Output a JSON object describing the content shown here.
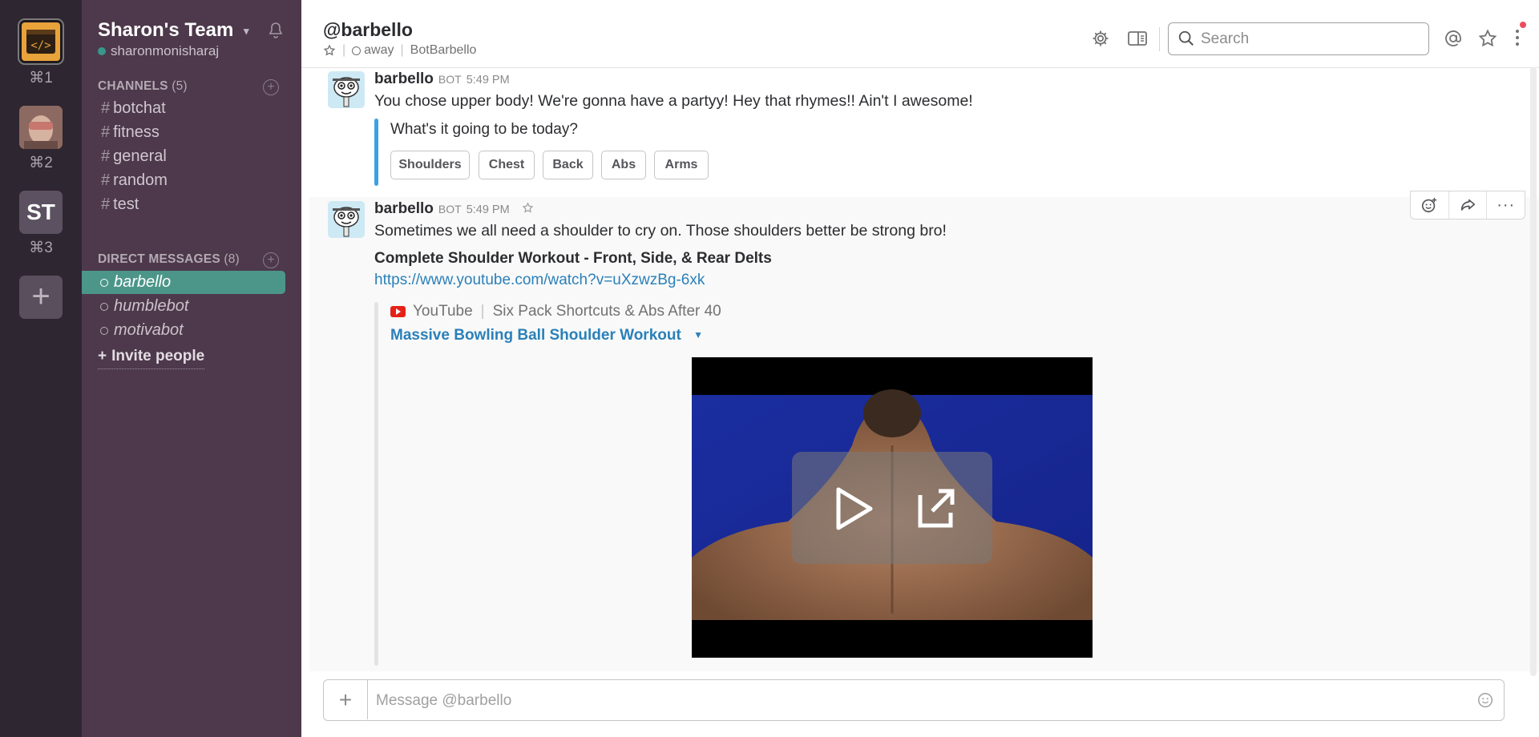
{
  "teams_rail": {
    "shortcuts": [
      "⌘1",
      "⌘2",
      "⌘3"
    ],
    "team3_initials": "ST"
  },
  "sidebar": {
    "team_name": "Sharon's Team",
    "username": "sharonmonisharaj",
    "channels_label": "CHANNELS",
    "channels_count": "(5)",
    "channels": [
      "botchat",
      "fitness",
      "general",
      "random",
      "test"
    ],
    "dms_label": "DIRECT MESSAGES",
    "dms_count": "(8)",
    "dms": [
      "barbello",
      "humblebot",
      "motivabot"
    ],
    "invite_label": "Invite people"
  },
  "header": {
    "title": "@barbello",
    "status": "away",
    "real_name": "BotBarbello",
    "search_placeholder": "Search"
  },
  "messages": [
    {
      "author": "barbello",
      "tag": "BOT",
      "time": "5:49 PM",
      "text": "You chose upper body! We're gonna have a partyy! Hey that rhymes!! Ain't I awesome!",
      "attachment_text": "What's it going to be today?",
      "buttons": [
        "Shoulders",
        "Chest",
        "Back",
        "Abs",
        "Arms"
      ]
    },
    {
      "author": "barbello",
      "tag": "BOT",
      "time": "5:49 PM",
      "text": "Sometimes we all need a shoulder to cry on. Those shoulders better be strong bro!",
      "link_title": "Complete Shoulder Workout - Front, Side, & Rear Delts",
      "link_url": "https://www.youtube.com/watch?v=uXzwzBg-6xk",
      "embed_source": "YouTube",
      "embed_channel": "Six Pack Shortcuts & Abs After 40",
      "embed_title": "Massive Bowling Ball Shoulder Workout"
    }
  ],
  "composer": {
    "placeholder": "Message @barbello"
  },
  "colors": {
    "sidebar_bg": "#4d394b",
    "rail_bg": "#2e2631",
    "active_dm": "#4c9689",
    "link": "#2a80b9",
    "attachment_bar": "#3aa3e3"
  }
}
